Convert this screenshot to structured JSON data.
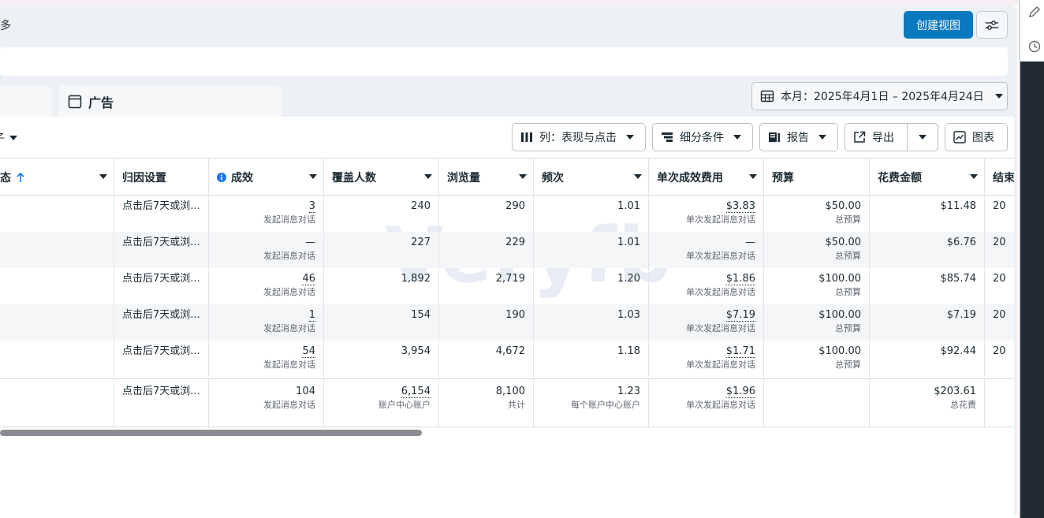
{
  "header": {
    "text": "多",
    "create_view_label": "创建视图"
  },
  "tabs": {
    "ads_label": "广告"
  },
  "date_range": {
    "label": "本月：2025年4月1日 – 2025年4月24日"
  },
  "toolbar": {
    "left_partial": "子",
    "columns_label": "列：表现与点击",
    "breakdown_label": "细分条件",
    "report_label": "报告",
    "export_label": "导出",
    "chart_label": "图表"
  },
  "columns": {
    "status": "态",
    "attribution": "归因设置",
    "results": "成效",
    "reach": "覆盖人数",
    "impressions": "浏览量",
    "frequency": "频次",
    "cost_per_result": "单次成效费用",
    "budget": "预算",
    "amount_spent": "花费金额",
    "ends": "结束"
  },
  "rows": [
    {
      "attribution": "点击后7天或浏...",
      "results": "3",
      "results_sub": "发起消息对话",
      "reach": "240",
      "impressions": "290",
      "frequency": "1.01",
      "cpr": "$3.83",
      "cpr_sub": "单次发起消息对话",
      "budget": "$50.00",
      "budget_sub": "总预算",
      "spent": "$11.48",
      "ends": "20"
    },
    {
      "attribution": "点击后7天或浏...",
      "results": "—",
      "results_sub": "发起消息对话",
      "reach": "227",
      "impressions": "229",
      "frequency": "1.01",
      "cpr": "—",
      "cpr_sub": "单次发起消息对话",
      "budget": "$50.00",
      "budget_sub": "总预算",
      "spent": "$6.76",
      "ends": "20"
    },
    {
      "attribution": "点击后7天或浏...",
      "results": "46",
      "results_sub": "发起消息对话",
      "reach": "1,892",
      "impressions": "2,719",
      "frequency": "1.20",
      "cpr": "$1.86",
      "cpr_sub": "单次发起消息对话",
      "budget": "$100.00",
      "budget_sub": "总预算",
      "spent": "$85.74",
      "ends": "20"
    },
    {
      "attribution": "点击后7天或浏...",
      "results": "1",
      "results_sub": "发起消息对话",
      "reach": "154",
      "impressions": "190",
      "frequency": "1.03",
      "cpr": "$7.19",
      "cpr_sub": "单次发起消息对话",
      "budget": "$100.00",
      "budget_sub": "总预算",
      "spent": "$7.19",
      "ends": "20"
    },
    {
      "attribution": "点击后7天或浏...",
      "results": "54",
      "results_sub": "发起消息对话",
      "reach": "3,954",
      "impressions": "4,672",
      "frequency": "1.18",
      "cpr": "$1.71",
      "cpr_sub": "单次发起消息对话",
      "budget": "$100.00",
      "budget_sub": "总预算",
      "spent": "$92.44",
      "ends": "20"
    }
  ],
  "totals": {
    "attribution": "点击后7天或浏...",
    "results": "104",
    "results_sub": "发起消息对话",
    "reach": "6,154",
    "reach_sub": "账户中心账户",
    "impressions": "8,100",
    "impressions_sub": "共计",
    "frequency": "1.23",
    "frequency_sub": "每个账户中心账户",
    "cpr": "$1.96",
    "cpr_sub": "单次发起消息对话",
    "spent": "$203.61",
    "spent_sub": "总花费"
  },
  "watermark": "Veryfb",
  "icons": {
    "settings": "sliders-icon",
    "calendar": "calendar-icon",
    "columns": "columns-icon",
    "breakdown": "breakdown-icon",
    "report": "report-icon",
    "export": "export-icon",
    "chart": "chart-icon",
    "info": "info-icon",
    "sort": "sort-up-arrow-icon",
    "pencil": "pencil-icon",
    "clock": "clock-icon"
  },
  "colors": {
    "primary": "#0a78be",
    "info": "#1877f2"
  }
}
